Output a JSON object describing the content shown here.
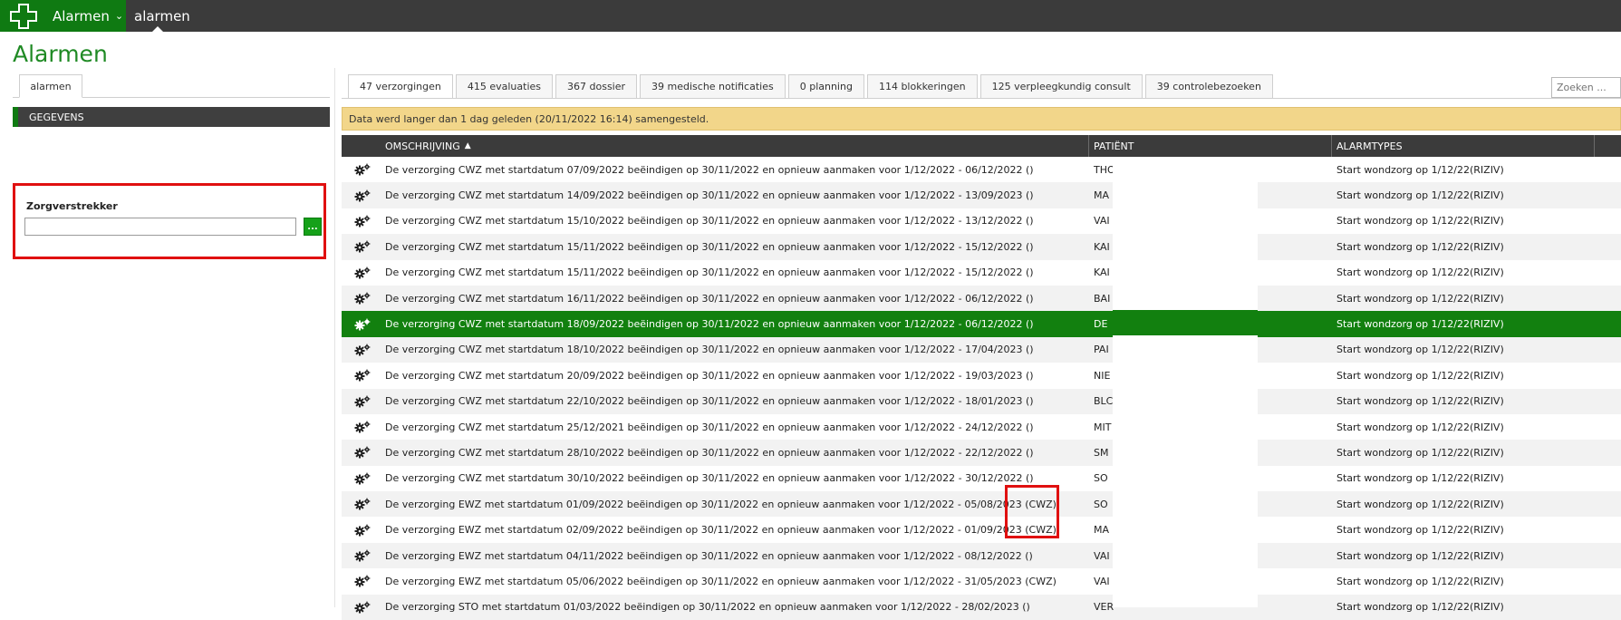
{
  "app": {
    "name": "Alarmen",
    "breadcrumb": "alarmen",
    "title": "Alarmen"
  },
  "left": {
    "tab": "alarmen",
    "section": "GEGEVENS",
    "filter_label": "Zorgverstrekker",
    "filter_value": "",
    "filter_button": "..."
  },
  "tabs": [
    "47 verzorgingen",
    "415 evaluaties",
    "367 dossier",
    "39 medische notificaties",
    "0 planning",
    "114 blokkeringen",
    "125 verpleegkundig consult",
    "39 controlebezoeken"
  ],
  "search": {
    "placeholder": "Zoeken ..."
  },
  "notice": "Data werd langer dan 1 dag geleden (20/11/2022 16:14) samengesteld.",
  "grid": {
    "columns": {
      "description": "OMSCHRIJVING",
      "patient": "PATIËNT",
      "alarmtypes": "ALARMTYPES"
    },
    "rows": [
      {
        "desc": "De verzorging CWZ met startdatum 07/09/2022 beëindigen op 30/11/2022 en opnieuw aanmaken voor 1/12/2022 - 06/12/2022 ()",
        "patient": "THO",
        "alarm": "Start wondzorg op 1/12/22(RIZIV)"
      },
      {
        "desc": "De verzorging CWZ met startdatum 14/09/2022 beëindigen op 30/11/2022 en opnieuw aanmaken voor 1/12/2022 - 13/09/2023 ()",
        "patient": "MA",
        "alarm": "Start wondzorg op 1/12/22(RIZIV)"
      },
      {
        "desc": "De verzorging CWZ met startdatum 15/10/2022 beëindigen op 30/11/2022 en opnieuw aanmaken voor 1/12/2022 - 13/12/2022 ()",
        "patient": "VAI",
        "alarm": "Start wondzorg op 1/12/22(RIZIV)"
      },
      {
        "desc": "De verzorging CWZ met startdatum 15/11/2022 beëindigen op 30/11/2022 en opnieuw aanmaken voor 1/12/2022 - 15/12/2022 ()",
        "patient": "KAI",
        "alarm": "Start wondzorg op 1/12/22(RIZIV)"
      },
      {
        "desc": "De verzorging CWZ met startdatum 15/11/2022 beëindigen op 30/11/2022 en opnieuw aanmaken voor 1/12/2022 - 15/12/2022 ()",
        "patient": "KAI",
        "alarm": "Start wondzorg op 1/12/22(RIZIV)"
      },
      {
        "desc": "De verzorging CWZ met startdatum 16/11/2022 beëindigen op 30/11/2022 en opnieuw aanmaken voor 1/12/2022 - 06/12/2022 ()",
        "patient": "BAI",
        "alarm": "Start wondzorg op 1/12/22(RIZIV)"
      },
      {
        "desc": "De verzorging CWZ met startdatum 18/09/2022 beëindigen op 30/11/2022 en opnieuw aanmaken voor 1/12/2022 - 06/12/2022 ()",
        "patient": "DE",
        "alarm": "Start wondzorg op 1/12/22(RIZIV)",
        "selected": true
      },
      {
        "desc": "De verzorging CWZ met startdatum 18/10/2022 beëindigen op 30/11/2022 en opnieuw aanmaken voor 1/12/2022 - 17/04/2023 ()",
        "patient": "PAI",
        "alarm": "Start wondzorg op 1/12/22(RIZIV)"
      },
      {
        "desc": "De verzorging CWZ met startdatum 20/09/2022 beëindigen op 30/11/2022 en opnieuw aanmaken voor 1/12/2022 - 19/03/2023 ()",
        "patient": "NIE",
        "alarm": "Start wondzorg op 1/12/22(RIZIV)"
      },
      {
        "desc": "De verzorging CWZ met startdatum 22/10/2022 beëindigen op 30/11/2022 en opnieuw aanmaken voor 1/12/2022 - 18/01/2023 ()",
        "patient": "BLC",
        "alarm": "Start wondzorg op 1/12/22(RIZIV)"
      },
      {
        "desc": "De verzorging CWZ met startdatum 25/12/2021 beëindigen op 30/11/2022 en opnieuw aanmaken voor 1/12/2022 - 24/12/2022 ()",
        "patient": "MIT",
        "alarm": "Start wondzorg op 1/12/22(RIZIV)"
      },
      {
        "desc": "De verzorging CWZ met startdatum 28/10/2022 beëindigen op 30/11/2022 en opnieuw aanmaken voor 1/12/2022 - 22/12/2022 ()",
        "patient": "SM",
        "alarm": "Start wondzorg op 1/12/22(RIZIV)"
      },
      {
        "desc": "De verzorging CWZ met startdatum 30/10/2022 beëindigen op 30/11/2022 en opnieuw aanmaken voor 1/12/2022 - 30/12/2022 ()",
        "patient": "SO",
        "alarm": "Start wondzorg op 1/12/22(RIZIV)"
      },
      {
        "desc": "De verzorging EWZ met startdatum 01/09/2022 beëindigen op 30/11/2022 en opnieuw aanmaken voor 1/12/2022 - 05/08/2023 (CWZ)",
        "patient": "SO",
        "alarm": "Start wondzorg op 1/12/22(RIZIV)"
      },
      {
        "desc": "De verzorging EWZ met startdatum 02/09/2022 beëindigen op 30/11/2022 en opnieuw aanmaken voor 1/12/2022 - 01/09/2023 (CWZ)",
        "patient": "MA",
        "alarm": "Start wondzorg op 1/12/22(RIZIV)"
      },
      {
        "desc": "De verzorging EWZ met startdatum 04/11/2022 beëindigen op 30/11/2022 en opnieuw aanmaken voor 1/12/2022 - 08/12/2022 ()",
        "patient": "VAI",
        "alarm": "Start wondzorg op 1/12/22(RIZIV)"
      },
      {
        "desc": "De verzorging EWZ met startdatum 05/06/2022 beëindigen op 30/11/2022 en opnieuw aanmaken voor 1/12/2022 - 31/05/2023 (CWZ)",
        "patient": "VAI",
        "alarm": "Start wondzorg op 1/12/22(RIZIV)"
      },
      {
        "desc": "De verzorging STO met startdatum 01/03/2022 beëindigen op 30/11/2022 en opnieuw aanmaken voor 1/12/2022 - 28/02/2023 ()",
        "patient": "VER",
        "alarm": "Start wondzorg op 1/12/22(RIZIV)"
      }
    ]
  },
  "colors": {
    "brand_green": "#0f7a12",
    "title_green": "#1f8a24",
    "selected_row": "#12800f",
    "notice": "#f2d68a",
    "highlight": "#e01010"
  }
}
